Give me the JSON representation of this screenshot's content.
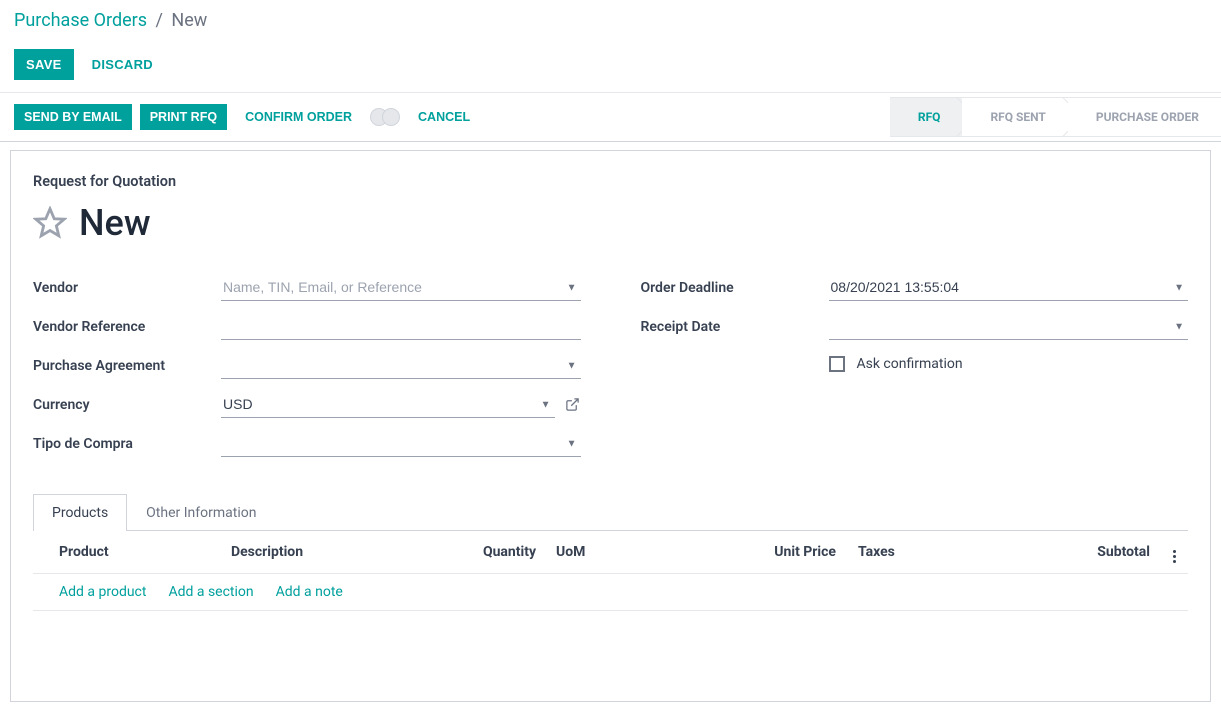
{
  "breadcrumb": {
    "root": "Purchase Orders",
    "current": "New"
  },
  "buttons": {
    "save": "SAVE",
    "discard": "DISCARD",
    "send_email": "SEND BY EMAIL",
    "print_rfq": "PRINT RFQ",
    "confirm": "CONFIRM ORDER",
    "cancel": "CANCEL"
  },
  "status": {
    "rfq": "RFQ",
    "rfq_sent": "RFQ SENT",
    "po": "PURCHASE ORDER"
  },
  "form": {
    "subtitle": "Request for Quotation",
    "title": "New",
    "labels": {
      "vendor": "Vendor",
      "vendor_ref": "Vendor Reference",
      "purchase_agreement": "Purchase Agreement",
      "currency": "Currency",
      "tipo_compra": "Tipo de Compra",
      "order_deadline": "Order Deadline",
      "receipt_date": "Receipt Date",
      "ask_confirm": "Ask confirmation"
    },
    "placeholders": {
      "vendor": "Name, TIN, Email, or Reference"
    },
    "values": {
      "vendor": "",
      "vendor_ref": "",
      "purchase_agreement": "",
      "currency": "USD",
      "tipo_compra": "",
      "order_deadline": "08/20/2021 13:55:04",
      "receipt_date": ""
    }
  },
  "tabs": {
    "products": "Products",
    "other": "Other Information"
  },
  "table": {
    "headers": {
      "product": "Product",
      "description": "Description",
      "quantity": "Quantity",
      "uom": "UoM",
      "unit_price": "Unit Price",
      "taxes": "Taxes",
      "subtotal": "Subtotal"
    },
    "actions": {
      "add_product": "Add a product",
      "add_section": "Add a section",
      "add_note": "Add a note"
    }
  }
}
